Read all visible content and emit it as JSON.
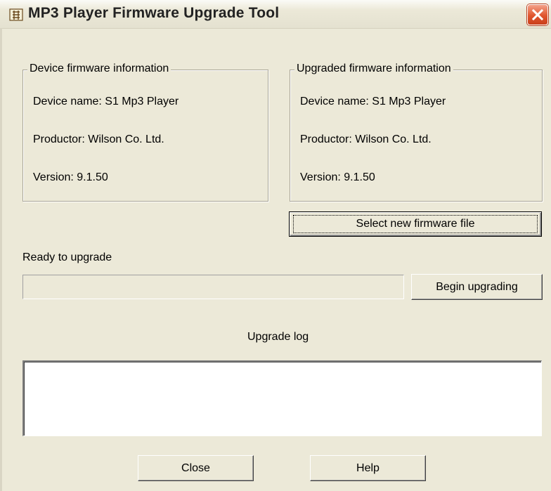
{
  "window": {
    "title": "MP3 Player Firmware Upgrade Tool",
    "icon": "speaker-app-icon",
    "close_icon": "close-icon"
  },
  "device_info": {
    "legend": "Device firmware information",
    "device_name": "Device name: S1 Mp3 Player",
    "productor": "Productor: Wilson Co. Ltd.",
    "version": "Version: 9.1.50"
  },
  "upgraded_info": {
    "legend": "Upgraded firmware information",
    "device_name": "Device name: S1 Mp3 Player",
    "productor": "Productor: Wilson Co. Ltd.",
    "version": "Version: 9.1.50"
  },
  "buttons": {
    "select_file": "Select new firmware file",
    "begin_upgrading": "Begin upgrading",
    "close": "Close",
    "help": "Help"
  },
  "status": {
    "text": "Ready to upgrade",
    "progress": 0
  },
  "log": {
    "label": "Upgrade log",
    "content": ""
  },
  "colors": {
    "face": "#ece9d8",
    "close_button": "#e0552e"
  }
}
